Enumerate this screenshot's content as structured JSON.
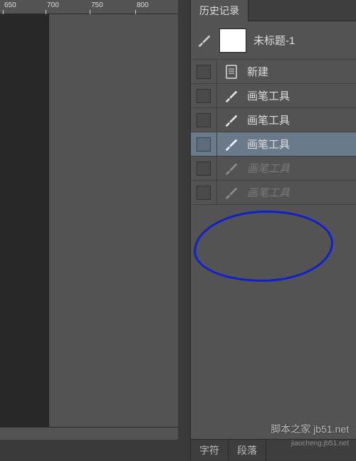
{
  "ruler": {
    "ticks": [
      "650",
      "700",
      "750",
      "800"
    ]
  },
  "panel": {
    "tab_label": "历史记录"
  },
  "source": {
    "label": "未标题-1"
  },
  "history_items": [
    {
      "label": "新建",
      "icon": "document",
      "selected": false,
      "disabled": false
    },
    {
      "label": "画笔工具",
      "icon": "brush",
      "selected": false,
      "disabled": false
    },
    {
      "label": "画笔工具",
      "icon": "brush",
      "selected": false,
      "disabled": false
    },
    {
      "label": "画笔工具",
      "icon": "brush",
      "selected": true,
      "disabled": false
    },
    {
      "label": "画笔工具",
      "icon": "brush",
      "selected": false,
      "disabled": true
    },
    {
      "label": "画笔工具",
      "icon": "brush",
      "selected": false,
      "disabled": true
    }
  ],
  "bottom_tabs": {
    "tab1": "字符",
    "tab2": "段落"
  },
  "watermark": {
    "main": "脚本之家 jb51.net",
    "sub": "jiaocheng.jb51.net"
  },
  "colors": {
    "brush_source": "#cfcfcf",
    "brush_list": "#e6e6e6",
    "annotation": "#1020d0"
  }
}
